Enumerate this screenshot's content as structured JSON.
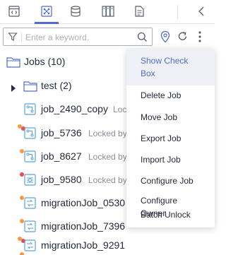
{
  "toolbar": {
    "icons": [
      "script-icon",
      "workflow-icon",
      "database-icon",
      "catalog-icon",
      "document-icon"
    ],
    "collapse_icon": "chevron-left-icon"
  },
  "search": {
    "placeholder": "Enter a keyword.",
    "value": ""
  },
  "tree": {
    "root": {
      "label": "Jobs",
      "count": "(10)"
    },
    "folder": {
      "label": "test",
      "count": "(2)"
    },
    "jobs": [
      {
        "name": "job_2490_copy",
        "lock": "Lock",
        "icon": "workflow-job-icon"
      },
      {
        "name": "job_5736",
        "lock": "Locked by",
        "icon": "workflow-job-icon"
      },
      {
        "name": "job_8627",
        "lock": "Locked by",
        "icon": "workflow-job-icon"
      },
      {
        "name": "job_9580",
        "lock": "Locked by",
        "icon": "batch-job-icon"
      },
      {
        "name": "migrationJob_0530",
        "lock": "",
        "icon": "migration-job-icon"
      },
      {
        "name": "migrationJob_7396",
        "lock": "",
        "icon": "migration-job-icon"
      },
      {
        "name": "migrationJob_9291",
        "lock": "",
        "icon": "migration-job-icon"
      }
    ]
  },
  "context_menu": {
    "items": [
      "Show Check Box",
      "Delete Job",
      "Move Job",
      "Export Job",
      "Import Job",
      "Configure Job",
      "Configure Owner",
      "Batch Unlock"
    ]
  },
  "colors": {
    "accent": "#526ecc",
    "status_orange": "#fa9841",
    "status_red": "#e84e51",
    "folder_blue": "#526ecc",
    "job_teal": "#5aa2dc"
  }
}
